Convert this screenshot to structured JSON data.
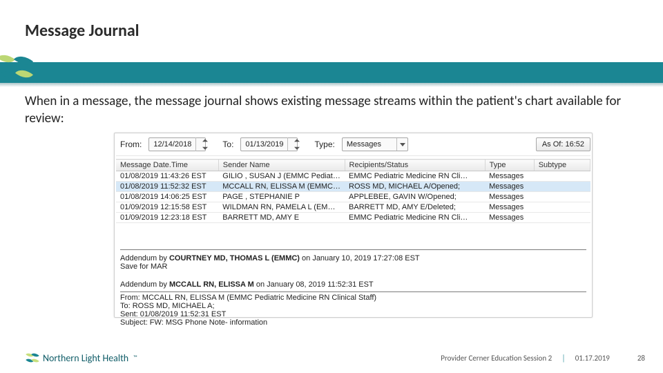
{
  "slide": {
    "title": "Message Journal",
    "description": "When in a message, the message journal shows existing message streams within the patient's chart available for review:"
  },
  "filterbar": {
    "from_label": "From:",
    "from_value": "12/14/2018",
    "to_label": "To:",
    "to_value": "01/13/2019",
    "type_label": "Type:",
    "type_value": "Messages",
    "asof_button": "As Of: 16:52"
  },
  "table": {
    "headers": {
      "datetime": "Message Date.Time",
      "sender": "Sender Name",
      "recipients": "Recipients/Status",
      "type": "Type",
      "subtype": "Subtype"
    },
    "rows": [
      {
        "dt": "01/08/2019 11:43:26 EST",
        "sender": "GILIO , SUSAN J (EMMC Pediatric …",
        "recip": "EMMC Pediatric Medicine RN Cli…",
        "type": "Messages",
        "sub": ""
      },
      {
        "dt": "01/08/2019 11:52:32 EST",
        "sender": "MCCALL RN, ELISSA M (EMMC P…",
        "recip": "ROSS MD, MICHAEL A/Opened;",
        "type": "Messages",
        "sub": ""
      },
      {
        "dt": "01/08/2019 14:06:25 EST",
        "sender": "PAGE , STEPHANIE P",
        "recip": "APPLEBEE, GAVIN W/Opened;",
        "type": "Messages",
        "sub": ""
      },
      {
        "dt": "01/09/2019 12:15:58 EST",
        "sender": "WILDMAN RN, PAMELA L (EMMC…",
        "recip": "BARRETT MD, AMY E/Deleted;",
        "type": "Messages",
        "sub": ""
      },
      {
        "dt": "01/09/2019 12:23:18 EST",
        "sender": "BARRETT MD, AMY E",
        "recip": "EMMC Pediatric Medicine RN Cli…",
        "type": "Messages",
        "sub": ""
      }
    ]
  },
  "addenda": [
    {
      "header_prefix": "Addendum by ",
      "author": "COURTNEY MD, THOMAS L (EMMC)",
      "header_suffix": " on January 10, 2019 17:27:08 EST",
      "body": "Save for MAR"
    },
    {
      "header_prefix": "Addendum by ",
      "author": "MCCALL RN, ELISSA M",
      "header_suffix": " on January 08, 2019 11:52:31 EST",
      "from": "From: MCCALL RN, ELISSA M (EMMC Pediatric Medicine RN Clinical Staff)",
      "to": "To: ROSS MD, MICHAEL A;",
      "sent": "Sent: 01/08/2019 11:52:31 EST",
      "subject": "Subject: FW: MSG Phone Note- information"
    }
  ],
  "footer": {
    "brand": "Northern Light Health",
    "session": "Provider Cerner Education Session 2",
    "date": "01.17.2019",
    "page": "28"
  }
}
